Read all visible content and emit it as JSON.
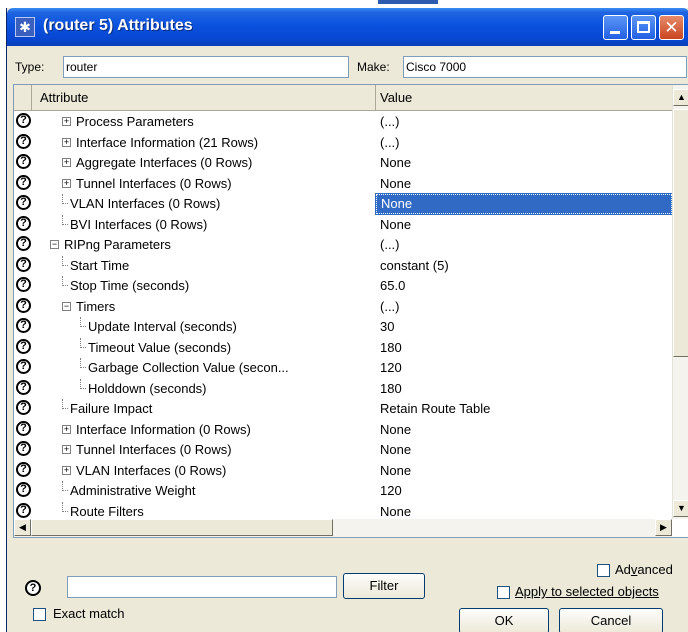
{
  "window": {
    "title": "(router 5) Attributes",
    "icon": "asterisk-star-icon"
  },
  "header": {
    "type_label": "Type:",
    "type_value": "router",
    "make_label": "Make:",
    "make_value": "Cisco 7000"
  },
  "grid": {
    "col_attribute": "Attribute",
    "col_value": "Value",
    "rows": [
      {
        "label": "Process Parameters",
        "value": "(...)",
        "expander": "plus"
      },
      {
        "label": "Interface Information (21 Rows)",
        "value": "(...)",
        "expander": "plus"
      },
      {
        "label": "Aggregate Interfaces (0 Rows)",
        "value": "None",
        "expander": "plus"
      },
      {
        "label": "Tunnel Interfaces (0 Rows)",
        "value": "None",
        "expander": "plus"
      },
      {
        "label": "VLAN Interfaces (0 Rows)",
        "value": "None",
        "expander": "leaf",
        "selected": true
      },
      {
        "label": "BVI Interfaces (0 Rows)",
        "value": "None",
        "expander": "leaf"
      },
      {
        "label": "RIPng Parameters",
        "value": "(...)",
        "expander": "minus"
      },
      {
        "label": "Start Time",
        "value": "constant (5)",
        "expander": "leaf"
      },
      {
        "label": "Stop Time (seconds)",
        "value": "65.0",
        "expander": "leaf"
      },
      {
        "label": "Timers",
        "value": "(...)",
        "expander": "minus"
      },
      {
        "label": "Update Interval (seconds)",
        "value": "30",
        "expander": "leaf"
      },
      {
        "label": "Timeout Value (seconds)",
        "value": "180",
        "expander": "leaf"
      },
      {
        "label": "Garbage Collection Value (secon...",
        "value": "120",
        "expander": "leaf"
      },
      {
        "label": "Holddown (seconds)",
        "value": "180",
        "expander": "leaf"
      },
      {
        "label": "Failure Impact",
        "value": "Retain Route Table",
        "expander": "leaf"
      },
      {
        "label": "Interface Information (0 Rows)",
        "value": "None",
        "expander": "plus"
      },
      {
        "label": "Tunnel Interfaces (0 Rows)",
        "value": "None",
        "expander": "plus"
      },
      {
        "label": "VLAN Interfaces (0 Rows)",
        "value": "None",
        "expander": "plus"
      },
      {
        "label": "Administrative Weight",
        "value": "120",
        "expander": "leaf"
      },
      {
        "label": "Route Filters",
        "value": "None",
        "expander": "leaf"
      }
    ]
  },
  "bottom": {
    "filter_button": "Filter",
    "exact_match": "Exact match",
    "advanced": "Advanced",
    "apply_selected": "Apply to selected objects",
    "ok_button": "OK",
    "cancel_button": "Cancel",
    "help_glyph": "?"
  }
}
